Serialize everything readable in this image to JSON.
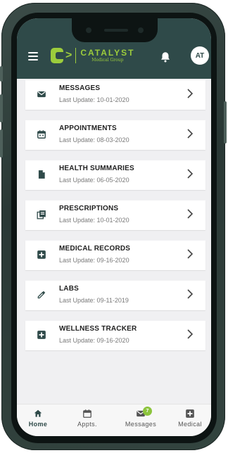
{
  "header": {
    "brand_name": "CATALYST",
    "brand_sub": "Medical Group",
    "avatar_initials": "AT",
    "brand_color": "#9ccc3c",
    "header_color": "#2f4a49"
  },
  "items": [
    {
      "title": "MESSAGES",
      "subtitle": "Last Update: 10-01-2020",
      "icon": "mail-icon"
    },
    {
      "title": "APPOINTMENTS",
      "subtitle": "Last Update: 08-03-2020",
      "icon": "calendar-icon"
    },
    {
      "title": "HEALTH SUMMARIES",
      "subtitle": "Last Update: 06-05-2020",
      "icon": "document-icon"
    },
    {
      "title": "PRESCRIPTIONS",
      "subtitle": "Last Update: 10-01-2020",
      "icon": "prescription-icon"
    },
    {
      "title": "MEDICAL RECORDS",
      "subtitle": "Last Update: 09-16-2020",
      "icon": "medical-plus-icon"
    },
    {
      "title": "LABS",
      "subtitle": "Last Update: 09-11-2019",
      "icon": "dropper-icon"
    },
    {
      "title": "WELLNESS TRACKER",
      "subtitle": "Last Update: 09-16-2020",
      "icon": "medical-plus-icon"
    }
  ],
  "tabs": [
    {
      "label": "Home",
      "icon": "home-icon",
      "active": true
    },
    {
      "label": "Appts.",
      "icon": "calendar-icon"
    },
    {
      "label": "Messages",
      "icon": "mail-icon",
      "badge": "7"
    },
    {
      "label": "Medical",
      "icon": "medical-plus-icon"
    }
  ]
}
